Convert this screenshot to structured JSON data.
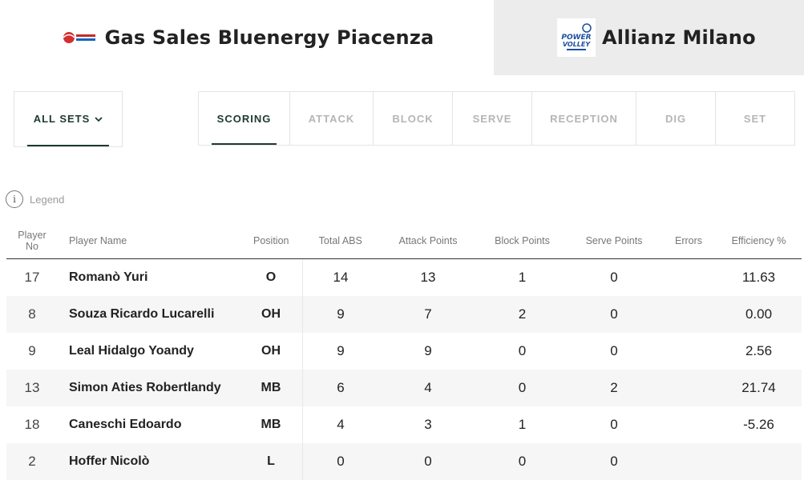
{
  "header": {
    "home_team": "Gas Sales Bluenergy Piacenza",
    "away_team": "Allianz Milano",
    "home_logo_icon": "piacenza-logo-icon",
    "away_logo_icon": "powervolley-milano-logo-icon",
    "away_logo_text": "POWER VOLLEY"
  },
  "filters": {
    "sets_label": "ALL SETS",
    "tabs": [
      {
        "label": "SCORING",
        "active": true
      },
      {
        "label": "ATTACK",
        "active": false
      },
      {
        "label": "BLOCK",
        "active": false
      },
      {
        "label": "SERVE",
        "active": false
      },
      {
        "label": "RECEPTION",
        "active": false
      },
      {
        "label": "DIG",
        "active": false
      },
      {
        "label": "SET",
        "active": false
      }
    ]
  },
  "legend": {
    "label": "Legend",
    "icon_text": "i"
  },
  "table": {
    "columns": {
      "no": "Player No",
      "name": "Player Name",
      "position": "Position",
      "total_abs": "Total ABS",
      "attack_points": "Attack Points",
      "block_points": "Block Points",
      "serve_points": "Serve Points",
      "errors": "Errors",
      "efficiency": "Efficiency %"
    },
    "rows": [
      {
        "no": "17",
        "name": "Romanò Yuri",
        "position": "O",
        "total_abs": "14",
        "attack_points": "13",
        "block_points": "1",
        "serve_points": "0",
        "errors": "",
        "efficiency": "11.63"
      },
      {
        "no": "8",
        "name": "Souza Ricardo Lucarelli",
        "position": "OH",
        "total_abs": "9",
        "attack_points": "7",
        "block_points": "2",
        "serve_points": "0",
        "errors": "",
        "efficiency": "0.00"
      },
      {
        "no": "9",
        "name": "Leal Hidalgo Yoandy",
        "position": "OH",
        "total_abs": "9",
        "attack_points": "9",
        "block_points": "0",
        "serve_points": "0",
        "errors": "",
        "efficiency": "2.56"
      },
      {
        "no": "13",
        "name": "Simon Aties Robertlandy",
        "position": "MB",
        "total_abs": "6",
        "attack_points": "4",
        "block_points": "0",
        "serve_points": "2",
        "errors": "",
        "efficiency": "21.74"
      },
      {
        "no": "18",
        "name": "Caneschi Edoardo",
        "position": "MB",
        "total_abs": "4",
        "attack_points": "3",
        "block_points": "1",
        "serve_points": "0",
        "errors": "",
        "efficiency": "-5.26"
      },
      {
        "no": "2",
        "name": "Hoffer Nicolò",
        "position": "L",
        "total_abs": "0",
        "attack_points": "0",
        "block_points": "0",
        "serve_points": "0",
        "errors": "",
        "efficiency": ""
      }
    ]
  },
  "colors": {
    "accent": "#1e3a30",
    "away_bg": "#ececec",
    "row_alt": "#f6f6f6"
  }
}
